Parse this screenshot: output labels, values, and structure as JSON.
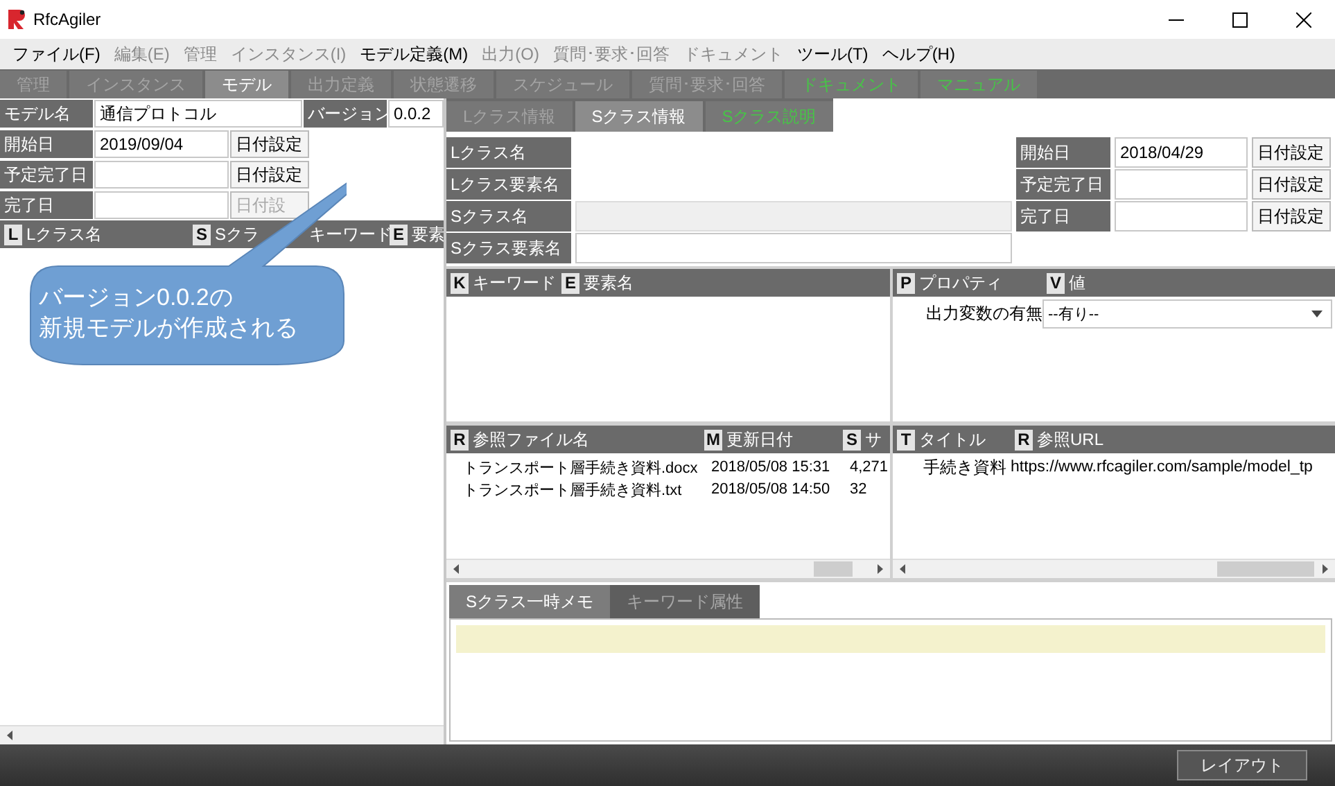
{
  "window": {
    "title": "RfcAgiler"
  },
  "menu": [
    {
      "label": "ファイル(F)",
      "disabled": false
    },
    {
      "label": "編集(E)",
      "disabled": true
    },
    {
      "label": "管理",
      "disabled": true
    },
    {
      "label": "インスタンス(I)",
      "disabled": true
    },
    {
      "label": "モデル定義(M)",
      "disabled": false
    },
    {
      "label": "出力(O)",
      "disabled": true
    },
    {
      "label": "質問･要求･回答",
      "disabled": true
    },
    {
      "label": "ドキュメント",
      "disabled": true
    },
    {
      "label": "ツール(T)",
      "disabled": false
    },
    {
      "label": "ヘルプ(H)",
      "disabled": false
    }
  ],
  "main_tabs": [
    {
      "label": "管理",
      "selected": false,
      "disabled": true,
      "kind": "normal"
    },
    {
      "label": "インスタンス",
      "selected": false,
      "disabled": true,
      "kind": "normal"
    },
    {
      "label": "モデル",
      "selected": true,
      "disabled": false,
      "kind": "normal"
    },
    {
      "label": "出力定義",
      "selected": false,
      "disabled": true,
      "kind": "normal"
    },
    {
      "label": "状態遷移",
      "selected": false,
      "disabled": true,
      "kind": "normal"
    },
    {
      "label": "スケジュール",
      "selected": false,
      "disabled": true,
      "kind": "normal"
    },
    {
      "label": "質問･要求･回答",
      "selected": false,
      "disabled": true,
      "kind": "normal"
    },
    {
      "label": "ドキュメント",
      "selected": false,
      "disabled": false,
      "kind": "green"
    },
    {
      "label": "マニュアル",
      "selected": false,
      "disabled": false,
      "kind": "green"
    }
  ],
  "model_form": {
    "name_label": "モデル名",
    "name": "通信プロトコル",
    "version_label": "バージョン",
    "version": "0.0.2",
    "dates": [
      {
        "label": "開始日",
        "value": "2019/09/04",
        "button": "日付設定",
        "disabled": false
      },
      {
        "label": "予定完了日",
        "button": "日付設定",
        "disabled": false
      },
      {
        "label": "完了日",
        "button": "日付設",
        "disabled": true
      }
    ]
  },
  "class_list": {
    "columns": [
      {
        "badge": "L",
        "label": "Lクラス名"
      },
      {
        "badge": "S",
        "label": "Sクラ"
      },
      {
        "label": "キーワード"
      },
      {
        "badge": "E",
        "label": "要素"
      }
    ]
  },
  "callout": {
    "lines": [
      "バージョン0.0.2の",
      "新規モデルが作成される"
    ]
  },
  "detail_tabs": [
    {
      "label": "Lクラス情報",
      "selected": false,
      "disabled": true,
      "kind": "normal"
    },
    {
      "label": "Sクラス情報",
      "selected": true,
      "disabled": false,
      "kind": "normal"
    },
    {
      "label": "Sクラス説明",
      "selected": false,
      "disabled": false,
      "kind": "green"
    }
  ],
  "class_form": {
    "fields": [
      {
        "label": "Lクラス名",
        "kind": "plain"
      },
      {
        "label": "Lクラス要素名",
        "kind": "plain"
      },
      {
        "label": "Sクラス名",
        "kind": "disabled"
      },
      {
        "label": "Sクラス要素名",
        "kind": "input"
      }
    ],
    "dates": [
      {
        "label": "開始日",
        "value": "2018/04/29",
        "button": "日付設定"
      },
      {
        "label": "予定完了日",
        "button": "日付設定"
      },
      {
        "label": "完了日",
        "button": "日付設定"
      }
    ]
  },
  "keyword_table": {
    "columns": [
      {
        "badge": "K",
        "label": "キーワード"
      },
      {
        "badge": "E",
        "label": "要素名"
      }
    ]
  },
  "property_table": {
    "columns": [
      {
        "badge": "P",
        "label": "プロパティ"
      },
      {
        "badge": "V",
        "label": "値"
      }
    ],
    "rows": [
      {
        "name": "出力変数の有無",
        "value": "--有り--"
      }
    ]
  },
  "file_table": {
    "columns": [
      {
        "badge": "R",
        "label": "参照ファイル名"
      },
      {
        "badge": "M",
        "label": "更新日付"
      },
      {
        "badge": "S",
        "label": "サ"
      }
    ],
    "rows": [
      [
        "トランスポート層手続き資料.docx",
        "2018/05/08 15:31",
        "4,271"
      ],
      [
        "トランスポート層手続き資料.txt",
        "2018/05/08 14:50",
        "32"
      ]
    ]
  },
  "url_table": {
    "columns": [
      {
        "badge": "T",
        "label": "タイトル"
      },
      {
        "badge": "R",
        "label": "参照URL"
      }
    ],
    "rows": [
      [
        "手続き資料",
        "https://www.rfcagiler.com/sample/model_tp"
      ]
    ]
  },
  "memo_tabs": [
    {
      "label": "Sクラス一時メモ",
      "selected": true
    },
    {
      "label": "キーワード属性",
      "selected": false
    }
  ],
  "status_bar": {
    "button": "レイアウト"
  }
}
